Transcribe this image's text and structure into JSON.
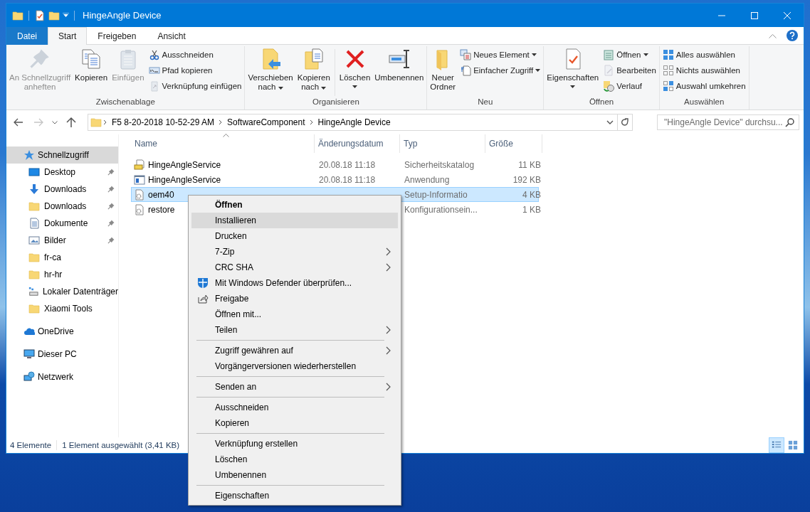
{
  "window": {
    "title": "HingeAngle Device"
  },
  "ribbon": {
    "tabs": [
      {
        "label": "Datei",
        "kind": "file",
        "selected": false
      },
      {
        "label": "Start",
        "kind": "tab",
        "selected": true
      },
      {
        "label": "Freigeben",
        "kind": "tab",
        "selected": false
      },
      {
        "label": "Ansicht",
        "kind": "tab",
        "selected": false
      }
    ],
    "groups": [
      {
        "label": "Zwischenablage",
        "buttons": [
          {
            "kind": "large",
            "label": "An Schnellzugriff\nanheften",
            "disabled": true,
            "dropdown": false
          },
          {
            "kind": "large",
            "label": "Kopieren",
            "disabled": false,
            "dropdown": false
          },
          {
            "kind": "large",
            "label": "Einfügen",
            "disabled": true,
            "dropdown": false
          },
          {
            "kind": "small",
            "label": "Ausschneiden",
            "disabled": false,
            "dropdown": false
          },
          {
            "kind": "small",
            "label": "Pfad kopieren",
            "disabled": false,
            "dropdown": false
          },
          {
            "kind": "small",
            "label": "Verknüpfung einfügen",
            "disabled": true,
            "dropdown": false
          }
        ]
      },
      {
        "label": "Organisieren",
        "buttons": [
          {
            "kind": "large",
            "label": "Verschieben\nnach",
            "disabled": false,
            "dropdown": true
          },
          {
            "kind": "large",
            "label": "Kopieren\nnach",
            "disabled": false,
            "dropdown": true
          },
          {
            "kind": "separator"
          },
          {
            "kind": "large",
            "label": "Löschen",
            "disabled": false,
            "dropdown": true
          },
          {
            "kind": "large",
            "label": "Umbenennen",
            "disabled": false,
            "dropdown": false
          }
        ]
      },
      {
        "label": "Neu",
        "buttons": [
          {
            "kind": "large",
            "label": "Neuer\nOrdner",
            "disabled": false,
            "dropdown": false
          },
          {
            "kind": "small",
            "label": "Neues Element",
            "disabled": false,
            "dropdown": true
          },
          {
            "kind": "small",
            "label": "Einfacher Zugriff",
            "disabled": false,
            "dropdown": true
          }
        ]
      },
      {
        "label": "Öffnen",
        "buttons": [
          {
            "kind": "large",
            "label": "Eigenschaften",
            "disabled": false,
            "dropdown": true
          },
          {
            "kind": "small",
            "label": "Öffnen",
            "disabled": false,
            "dropdown": true
          },
          {
            "kind": "small",
            "label": "Bearbeiten",
            "disabled": true,
            "dropdown": false
          },
          {
            "kind": "small",
            "label": "Verlauf",
            "disabled": false,
            "dropdown": false
          }
        ]
      },
      {
        "label": "Auswählen",
        "buttons": [
          {
            "kind": "small",
            "label": "Alles auswählen",
            "disabled": false,
            "dropdown": false
          },
          {
            "kind": "small",
            "label": "Nichts auswählen",
            "disabled": false,
            "dropdown": false
          },
          {
            "kind": "small",
            "label": "Auswahl umkehren",
            "disabled": false,
            "dropdown": false
          }
        ]
      }
    ]
  },
  "address": {
    "back": {
      "disabled": false
    },
    "forward": {
      "disabled": true
    },
    "path": [
      "F5 8-20-2018 10-52-29 AM",
      "SoftwareComponent",
      "HingeAngle Device"
    ],
    "search": {
      "placeholder": "\"HingeAngle Device\" durchsu..."
    }
  },
  "sidebar": {
    "items": [
      {
        "label": "Schnellzugriff",
        "selected": true,
        "children": [
          {
            "label": "Desktop",
            "pinned": true,
            "selected": false
          },
          {
            "label": "Downloads",
            "pinned": true,
            "selected": false
          },
          {
            "label": "Downloads",
            "pinned": true,
            "selected": false
          },
          {
            "label": "Dokumente",
            "pinned": true,
            "selected": false
          },
          {
            "label": "Bilder",
            "pinned": true,
            "selected": false
          },
          {
            "label": "fr-ca",
            "pinned": false,
            "selected": false
          },
          {
            "label": "hr-hr",
            "pinned": false,
            "selected": false
          },
          {
            "label": "Lokaler Datenträger",
            "pinned": false,
            "selected": false
          },
          {
            "label": "Xiaomi Tools",
            "pinned": false,
            "selected": false
          }
        ]
      },
      {
        "label": "OneDrive",
        "selected": false
      },
      {
        "label": "Dieser PC",
        "selected": false
      },
      {
        "label": "Netzwerk",
        "selected": false
      }
    ]
  },
  "table": {
    "columns": [
      {
        "label": "Name",
        "sorted": true
      },
      {
        "label": "Änderungsdatum",
        "sorted": false
      },
      {
        "label": "Typ",
        "sorted": false
      },
      {
        "label": "Größe",
        "sorted": false
      }
    ],
    "rows": [
      {
        "name": "HingeAngleService",
        "date": "20.08.18 11:18",
        "type": "Sicherheitskatalog",
        "size": "11 KB",
        "selected": false
      },
      {
        "name": "HingeAngleService",
        "date": "20.08.18 11:18",
        "type": "Anwendung",
        "size": "192 KB",
        "selected": false
      },
      {
        "name": "oem40",
        "type": "Setup-Informatio",
        "size": "4 KB",
        "selected": true
      },
      {
        "name": "restore",
        "type": "Konfigurationsein...",
        "size": "1 KB",
        "selected": false
      }
    ]
  },
  "status_bar": {
    "count": "4 Elemente",
    "selection": "1 Element ausgewählt (3,41 KB)",
    "views": [
      {
        "selected": true
      },
      {
        "selected": false
      }
    ]
  },
  "context_menu": {
    "items": [
      {
        "kind": "item",
        "label": "Öffnen",
        "default": true,
        "selected": false,
        "submenu": false
      },
      {
        "kind": "item",
        "label": "Installieren",
        "default": false,
        "selected": true,
        "submenu": false
      },
      {
        "kind": "item",
        "label": "Drucken",
        "default": false,
        "selected": false,
        "submenu": false
      },
      {
        "kind": "item",
        "label": "7-Zip",
        "default": false,
        "selected": false,
        "submenu": true
      },
      {
        "kind": "item",
        "label": "CRC SHA",
        "default": false,
        "selected": false,
        "submenu": true
      },
      {
        "kind": "item",
        "label": "Mit Windows Defender überprüfen...",
        "default": false,
        "selected": false,
        "submenu": false
      },
      {
        "kind": "item",
        "label": "Freigabe",
        "default": false,
        "selected": false,
        "submenu": false
      },
      {
        "kind": "item",
        "label": "Öffnen mit...",
        "default": false,
        "selected": false,
        "submenu": false
      },
      {
        "kind": "item",
        "label": "Teilen",
        "default": false,
        "selected": false,
        "submenu": true
      },
      {
        "kind": "separator"
      },
      {
        "kind": "item",
        "label": "Zugriff gewähren auf",
        "default": false,
        "selected": false,
        "submenu": true
      },
      {
        "kind": "item",
        "label": "Vorgängerversionen wiederherstellen",
        "default": false,
        "selected": false,
        "submenu": false
      },
      {
        "kind": "separator"
      },
      {
        "kind": "item",
        "label": "Senden an",
        "default": false,
        "selected": false,
        "submenu": true
      },
      {
        "kind": "separator"
      },
      {
        "kind": "item",
        "label": "Ausschneiden",
        "default": false,
        "selected": false,
        "submenu": false
      },
      {
        "kind": "item",
        "label": "Kopieren",
        "default": false,
        "selected": false,
        "submenu": false
      },
      {
        "kind": "separator"
      },
      {
        "kind": "item",
        "label": "Verknüpfung erstellen",
        "default": false,
        "selected": false,
        "submenu": false
      },
      {
        "kind": "item",
        "label": "Löschen",
        "default": false,
        "selected": false,
        "submenu": false
      },
      {
        "kind": "item",
        "label": "Umbenennen",
        "default": false,
        "selected": false,
        "submenu": false
      },
      {
        "kind": "separator"
      },
      {
        "kind": "item",
        "label": "Eigenschaften",
        "default": false,
        "selected": false,
        "submenu": false
      }
    ]
  }
}
